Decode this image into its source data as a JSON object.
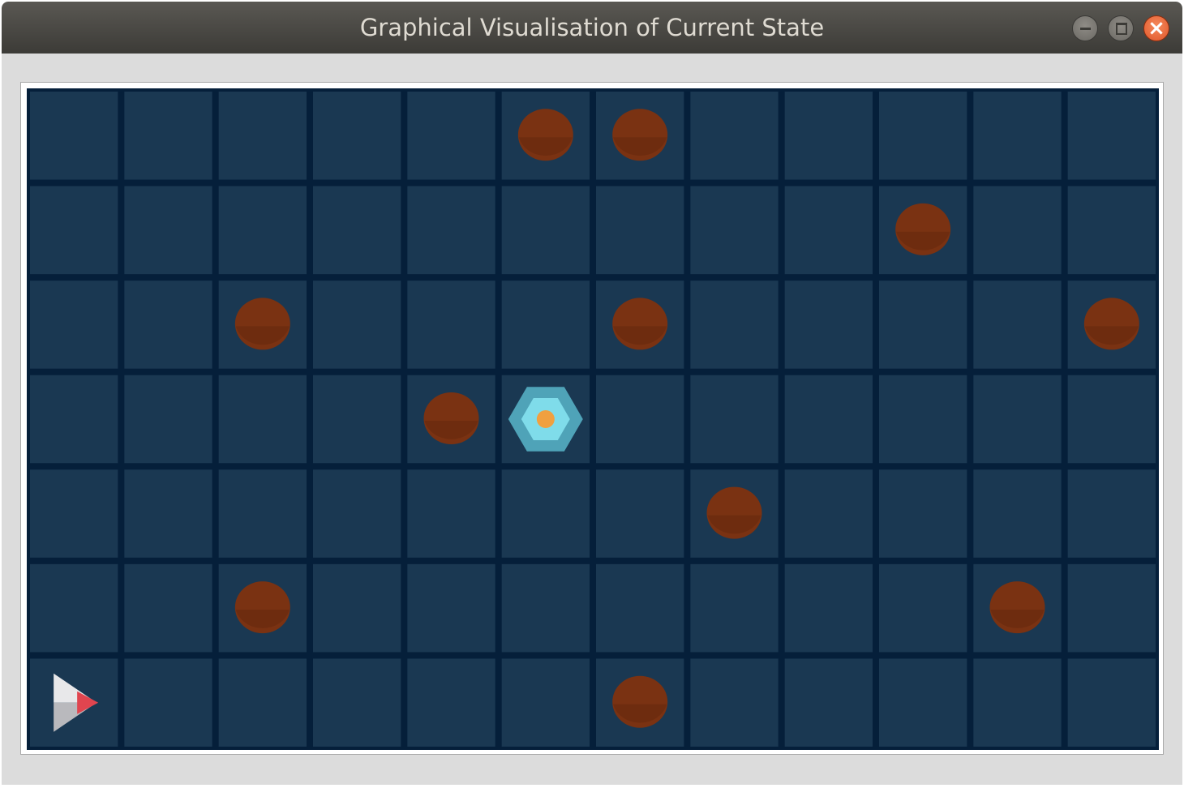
{
  "window": {
    "title": "Graphical Visualisation of Current State",
    "controls": [
      "minimize",
      "maximize",
      "close"
    ]
  },
  "board": {
    "columns": 12,
    "rows": 7,
    "background_color": "#051f3a",
    "cell_color": "#1a3852",
    "obstacle_color": "#7a3212",
    "goal": {
      "col": 5,
      "row": 3,
      "icon": "hexagon-goal-icon",
      "outer_color": "#4fa3b8",
      "inner_color": "#7fdcea",
      "core_color": "#f0a040"
    },
    "agent": {
      "col": 0,
      "row": 6,
      "icon": "arrow-agent-icon",
      "facing": "right"
    },
    "obstacles": [
      {
        "col": 5,
        "row": 0
      },
      {
        "col": 6,
        "row": 0
      },
      {
        "col": 9,
        "row": 1
      },
      {
        "col": 2,
        "row": 2
      },
      {
        "col": 6,
        "row": 2
      },
      {
        "col": 11,
        "row": 2
      },
      {
        "col": 4,
        "row": 3
      },
      {
        "col": 7,
        "row": 4
      },
      {
        "col": 2,
        "row": 5
      },
      {
        "col": 10,
        "row": 5
      },
      {
        "col": 6,
        "row": 6
      }
    ]
  }
}
